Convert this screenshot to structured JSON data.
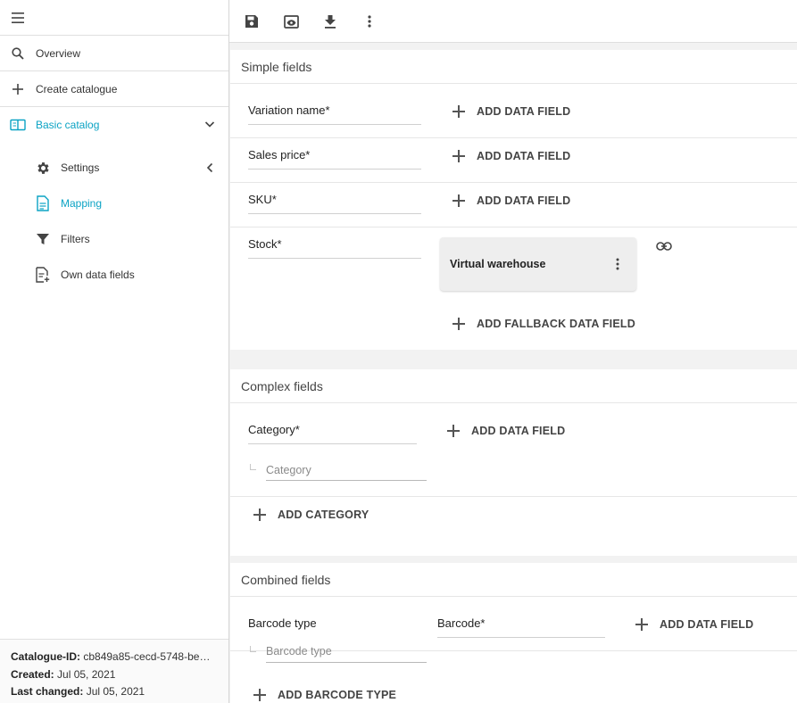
{
  "sidebar": {
    "menu_icon": "hamburger-menu-icon",
    "items": [
      {
        "label": "Overview",
        "icon": "search-icon"
      },
      {
        "label": "Create catalogue",
        "icon": "plus-icon"
      },
      {
        "label": "Basic catalog",
        "icon": "book-icon"
      }
    ],
    "sub_items": [
      {
        "label": "Settings",
        "icon": "gear-icon"
      },
      {
        "label": "Mapping",
        "icon": "document-icon"
      },
      {
        "label": "Filters",
        "icon": "filter-icon"
      },
      {
        "label": "Own data fields",
        "icon": "document-add-icon"
      }
    ],
    "footer": {
      "id_label": "Catalogue-ID:",
      "id_value": "cb849a85-cecd-5748-be…",
      "created_label": "Created:",
      "created_value": "Jul 05, 2021",
      "changed_label": "Last changed:",
      "changed_value": "Jul 05, 2021"
    }
  },
  "toolbar": {
    "icons": [
      "save-icon",
      "preview-icon",
      "download-icon",
      "more-vert-icon"
    ]
  },
  "simple": {
    "title": "Simple fields",
    "rows": [
      {
        "label": "Variation name*",
        "action": "ADD DATA FIELD"
      },
      {
        "label": "Sales price*",
        "action": "ADD DATA FIELD"
      },
      {
        "label": "SKU*",
        "action": "ADD DATA FIELD"
      }
    ],
    "stock": {
      "label": "Stock*",
      "chip": "Virtual warehouse",
      "fallback": "ADD FALLBACK DATA FIELD"
    }
  },
  "complex": {
    "title": "Complex fields",
    "category_label": "Category*",
    "action": "ADD DATA FIELD",
    "sub_placeholder": "Category",
    "add_category": "ADD CATEGORY"
  },
  "combined": {
    "title": "Combined fields",
    "barcode_type_label": "Barcode type",
    "barcode_label": "Barcode*",
    "action": "ADD DATA FIELD",
    "sub_placeholder": "Barcode type",
    "add_barcode_type": "ADD BARCODE TYPE"
  },
  "colors": {
    "accent": "#0ba3c4",
    "background": "#f2f2f2",
    "chip": "#eeeeee"
  }
}
